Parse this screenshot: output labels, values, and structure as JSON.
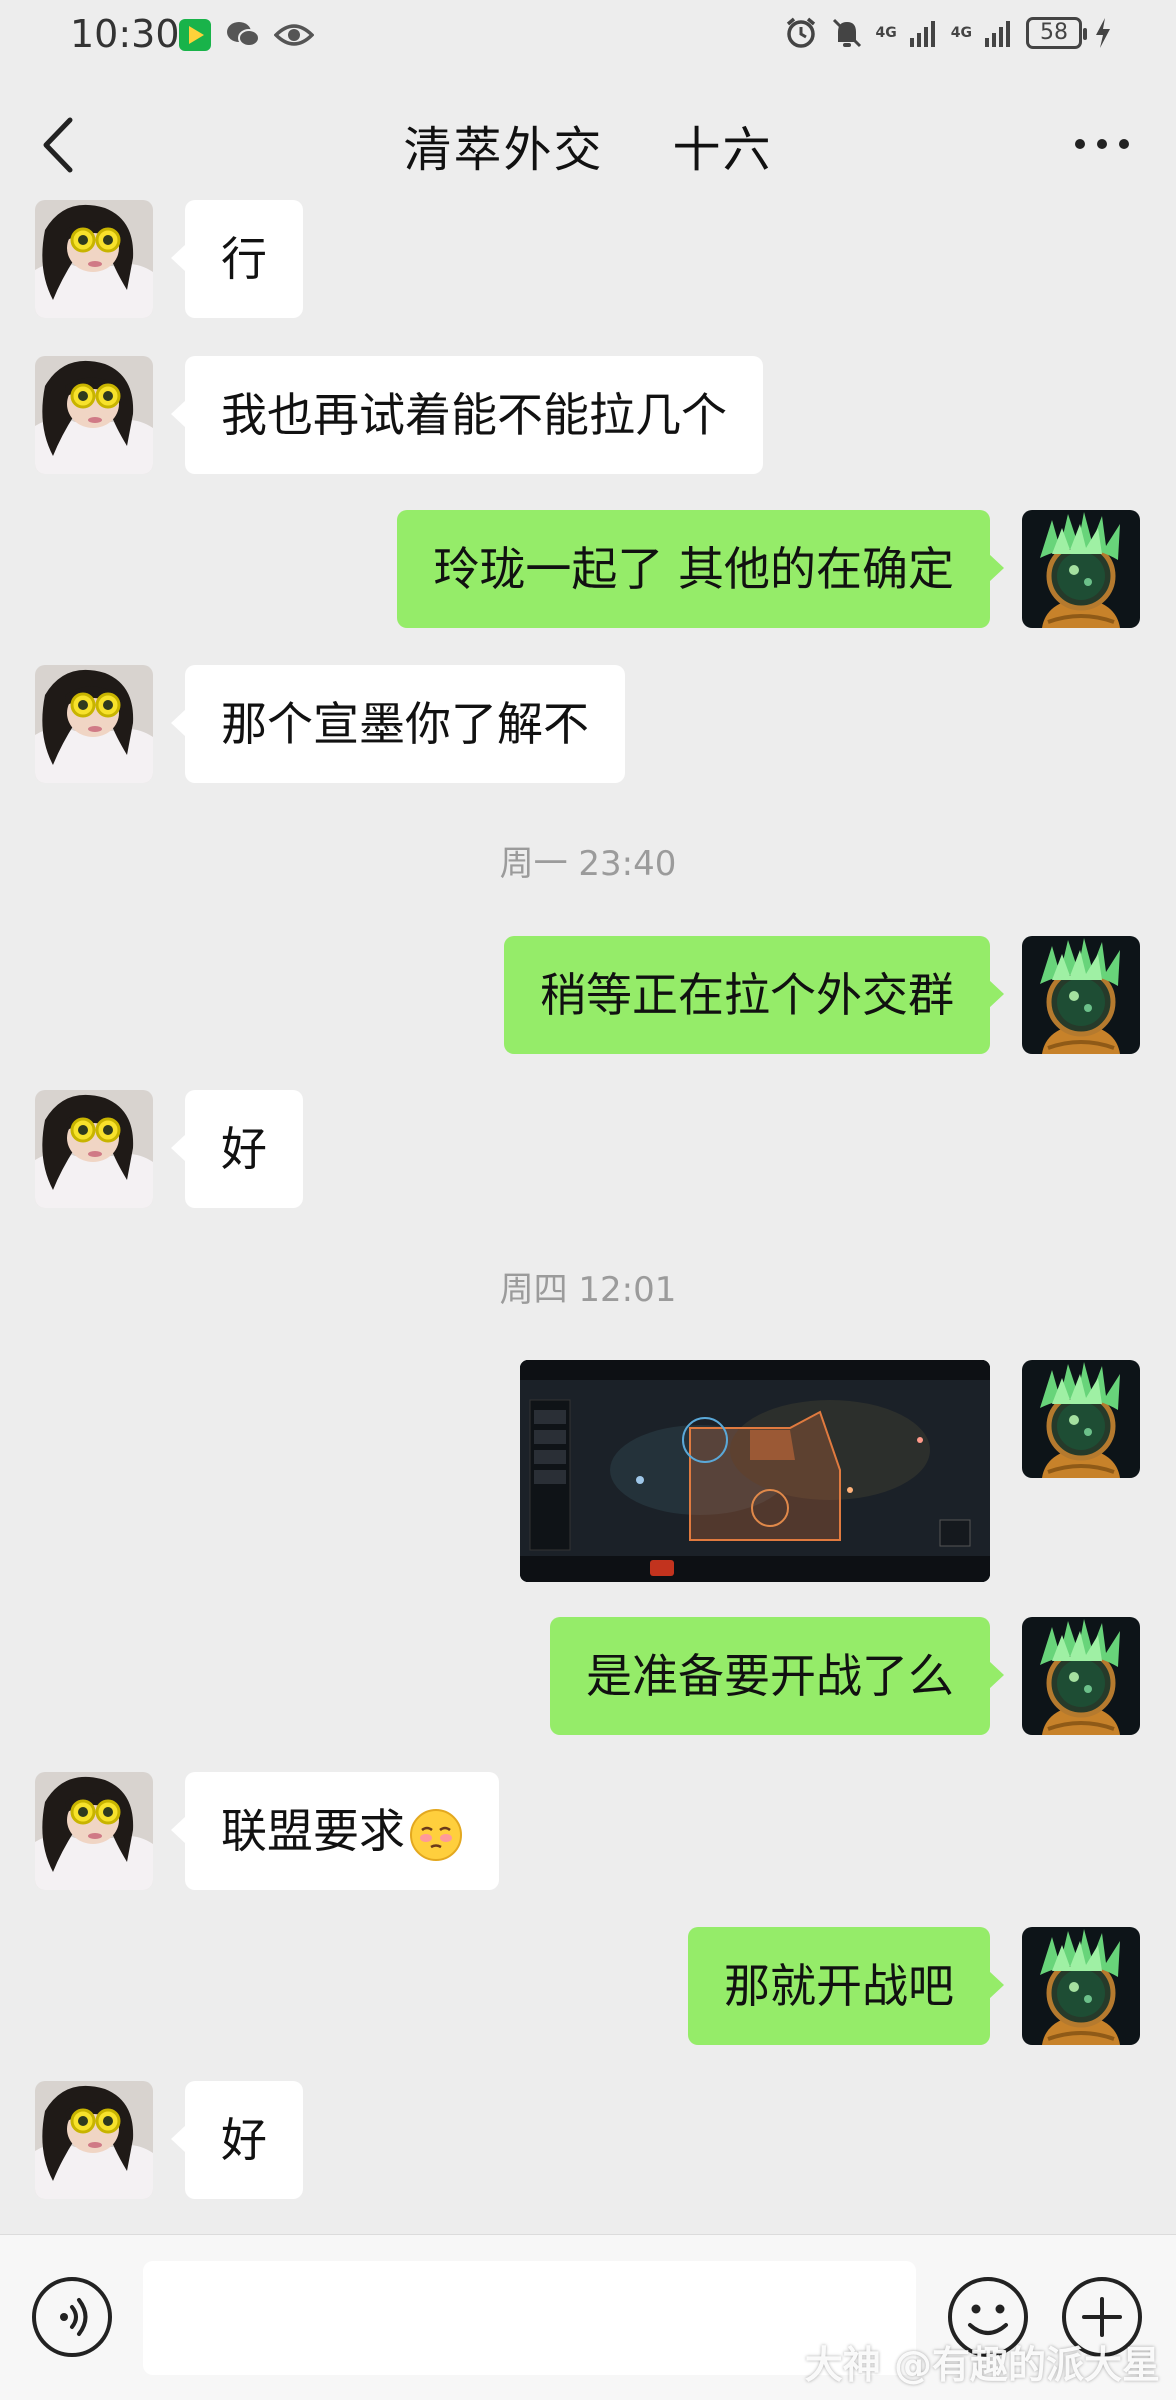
{
  "status_bar": {
    "time": "10:30",
    "net1": "4G",
    "net2": "4G",
    "battery": "58"
  },
  "header": {
    "title": "清萃外交    十六"
  },
  "messages": [
    {
      "side": "in",
      "text": "行"
    },
    {
      "side": "in",
      "text": "我也再试着能不能拉几个"
    },
    {
      "side": "out",
      "text": "玲珑一起了 其他的在确定"
    },
    {
      "side": "in",
      "text": "那个宣墨你了解不"
    },
    {
      "type": "time",
      "text": "周一 23:40"
    },
    {
      "side": "out",
      "text": "稍等正在拉个外交群"
    },
    {
      "side": "in",
      "text": "好"
    },
    {
      "type": "time",
      "text": "周四 12:01"
    },
    {
      "side": "out",
      "type": "image",
      "image": "game-screenshot-thumbnail"
    },
    {
      "side": "out",
      "text": "是准备要开战了么"
    },
    {
      "side": "in",
      "text": "联盟要求",
      "emoji": "pleading-face-emoji"
    },
    {
      "side": "out",
      "text": "那就开战吧"
    },
    {
      "side": "in",
      "text": "好"
    }
  ],
  "input_bar": {
    "value": "",
    "voice_icon": "voice-icon",
    "emoji_icon": "emoji-icon",
    "plus_icon": "plus-icon"
  },
  "watermark": "大神 @有趣的派大星",
  "colors": {
    "background": "#ededed",
    "incoming_bubble": "#ffffff",
    "outgoing_bubble": "#95ec69"
  }
}
